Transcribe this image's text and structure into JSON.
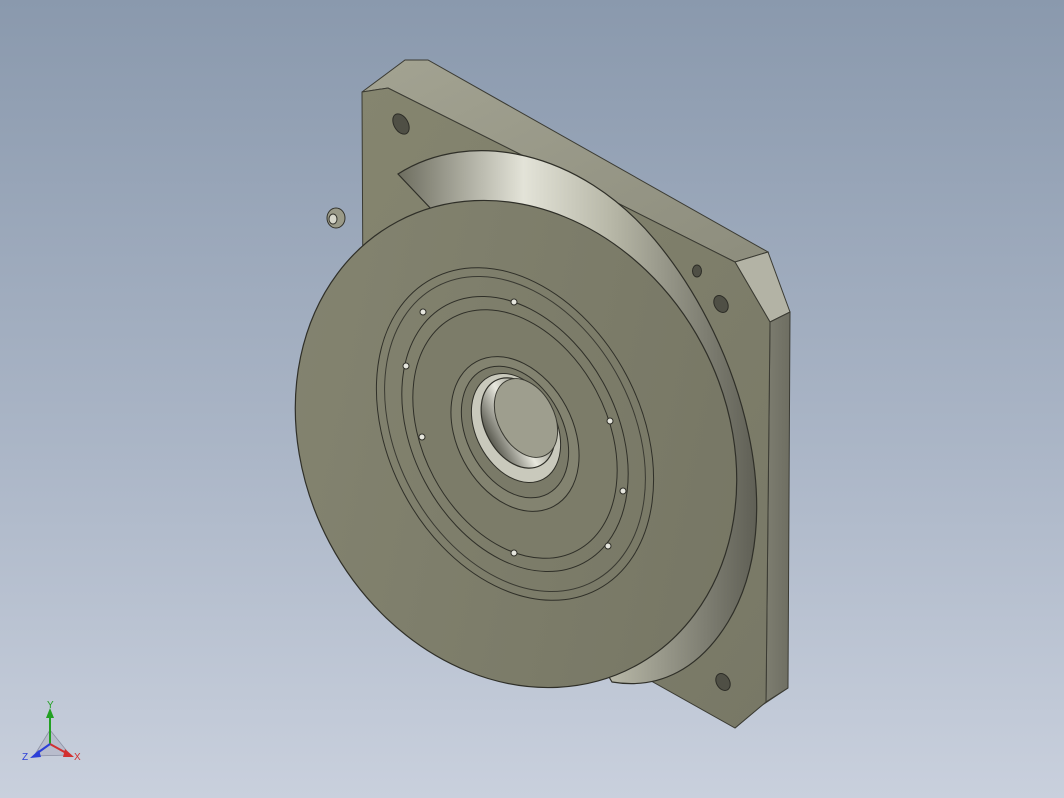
{
  "viewport": {
    "background_top": "#8a99ad",
    "background_bottom": "#c9d0dd"
  },
  "model": {
    "shading_color": "#7a7a6a"
  },
  "triad": {
    "x_label": "X",
    "y_label": "Y",
    "z_label": "Z",
    "x_color": "#d23030",
    "y_color": "#22a022",
    "z_color": "#2c3fd8"
  }
}
